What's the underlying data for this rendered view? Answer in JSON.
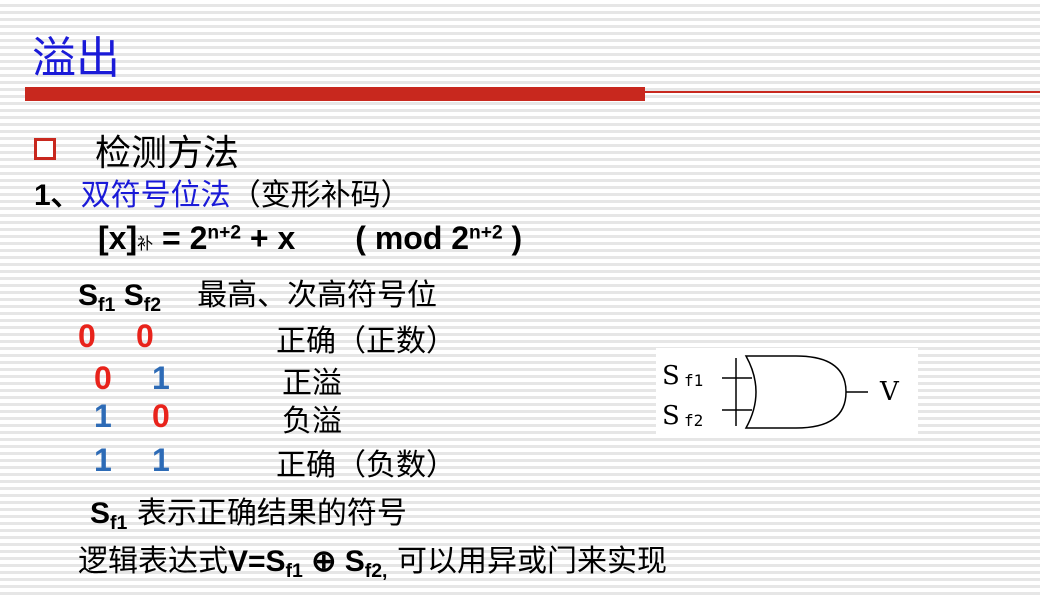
{
  "title": "溢出",
  "section_heading": "检测方法",
  "method": {
    "number": "1、",
    "name": "双符号位法",
    "paren": "（变形补码）"
  },
  "formula": {
    "lhs": "[x]",
    "lhs_sub": "补",
    "eq": " = 2",
    "exp1": "n+2",
    "plus": " + x",
    "mod_open": "( mod 2",
    "exp2": "n+2",
    "mod_close": " )"
  },
  "sign_bits": {
    "s": "S",
    "f1": "f1",
    "f2": "f2",
    "desc": "最高、次高符号位"
  },
  "table": [
    {
      "a": "0",
      "b": "0",
      "meaning": "正确（正数）"
    },
    {
      "a": "0",
      "b": "1",
      "meaning": "正溢"
    },
    {
      "a": "1",
      "b": "0",
      "meaning": "负溢"
    },
    {
      "a": "1",
      "b": "1",
      "meaning": "正确（负数）"
    }
  ],
  "gate": {
    "in1": "S",
    "in1_sub": "f1",
    "in2": "S",
    "in2_sub": "f2",
    "out": "V"
  },
  "note": {
    "s": "S",
    "sub": "f1",
    "text": " 表示正确结果的符号"
  },
  "logic": {
    "prefix": "逻辑表达式",
    "v": "V=S",
    "sub1": "f1",
    "xor": " ⊕ S",
    "sub2": "f2,",
    "suffix": " 可以用异或门来实现"
  },
  "colors": {
    "title": "#1a1ad8",
    "accent": "#c8281e",
    "bit_red": "#e8231b",
    "bit_blue": "#2d6bb6"
  }
}
